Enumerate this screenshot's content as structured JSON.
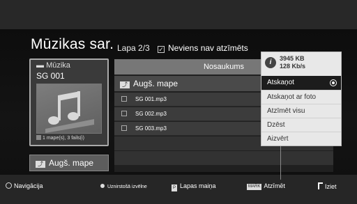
{
  "header": {
    "title": "Mūzikas sar.",
    "page_info": "Lapa 2/3",
    "mark_status": "Neviens nav atzīmēts"
  },
  "folder_card": {
    "crumb": "Mūzika",
    "folder_name": "SG 001",
    "summary": "1 mape(s), 3 fails(i)"
  },
  "up_button": {
    "label": "Augš. mape"
  },
  "list": {
    "column_header": "Nosaukums",
    "parent_row": "Augš. mape",
    "files": [
      {
        "name": "SG 001.mp3"
      },
      {
        "name": "SG 002.mp3"
      },
      {
        "name": "SG 003.mp3"
      }
    ]
  },
  "options_menu": {
    "info": {
      "size": "3945 KB",
      "bitrate": "128 Kb/s"
    },
    "items": [
      {
        "label": "Atskaņot",
        "selected": true
      },
      {
        "label": "Atskaņot ar foto"
      },
      {
        "label": "Atzīmēt visu"
      },
      {
        "label": "Dzēst"
      },
      {
        "label": "Aizvērt"
      }
    ]
  },
  "help_bar": {
    "navigation": "Navigācija",
    "options": "Uznirstošā izvēlne",
    "page_change": "Lapas maiņa",
    "mark_key": "MARK",
    "mark": "Atzīmēt",
    "exit": "Iziet"
  },
  "icons": {
    "folder": "folder-icon",
    "note": "music-note-icon",
    "info": "info-icon",
    "up": "up-folder-icon",
    "nav": "nav-dpad-icon",
    "exit": "exit-icon"
  }
}
